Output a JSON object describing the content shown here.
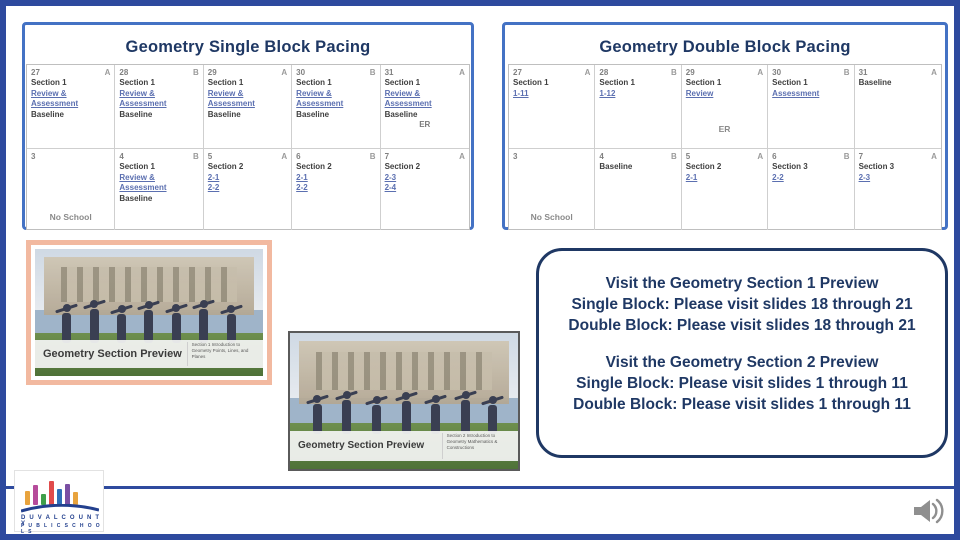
{
  "slide": {
    "accent_border": "#2e4a9e",
    "panel_border": "#4472c4",
    "title_color": "#1f3864"
  },
  "single_block": {
    "title": "Geometry Single Block Pacing",
    "row1": [
      {
        "num": "27",
        "letter": "A",
        "lines": [
          "Section 1",
          "Review &",
          "Assessment",
          "Baseline"
        ],
        "link_lines": [
          1,
          2
        ]
      },
      {
        "num": "28",
        "letter": "B",
        "lines": [
          "Section 1",
          "Review &",
          "Assessment",
          "Baseline"
        ],
        "link_lines": [
          1,
          2
        ]
      },
      {
        "num": "29",
        "letter": "A",
        "lines": [
          "Section 1",
          "Review &",
          "Assessment",
          "Baseline"
        ],
        "link_lines": [
          1,
          2
        ]
      },
      {
        "num": "30",
        "letter": "B",
        "lines": [
          "Section 1",
          "Review &",
          "Assessment",
          "Baseline"
        ],
        "link_lines": [
          1,
          2
        ]
      },
      {
        "num": "31",
        "letter": "A",
        "lines": [
          "Section 1",
          "Review &",
          "Assessment",
          "Baseline",
          "ER"
        ],
        "link_lines": [
          1,
          2
        ]
      }
    ],
    "row2": [
      {
        "num": "3",
        "letter": "",
        "lines": [],
        "note": "No School"
      },
      {
        "num": "4",
        "letter": "B",
        "lines": [
          "Section 1",
          "Review &",
          "Assessment",
          "Baseline"
        ],
        "link_lines": [
          1,
          2
        ]
      },
      {
        "num": "5",
        "letter": "A",
        "lines": [
          "Section 2",
          "2-1",
          "2-2"
        ],
        "link_lines": [
          1,
          2
        ]
      },
      {
        "num": "6",
        "letter": "B",
        "lines": [
          "Section 2",
          "2-1",
          "2-2"
        ],
        "link_lines": [
          1,
          2
        ]
      },
      {
        "num": "7",
        "letter": "A",
        "lines": [
          "Section 2",
          "2-3",
          "2-4"
        ],
        "link_lines": [
          1,
          2
        ]
      }
    ]
  },
  "double_block": {
    "title": "Geometry Double Block Pacing",
    "row1": [
      {
        "num": "27",
        "letter": "A",
        "lines": [
          "Section 1",
          "1-11"
        ],
        "link_lines": [
          1
        ]
      },
      {
        "num": "28",
        "letter": "B",
        "lines": [
          "Section 1",
          "1-12"
        ],
        "link_lines": [
          1
        ]
      },
      {
        "num": "29",
        "letter": "A",
        "lines": [
          "Section 1",
          "Review"
        ],
        "link_lines": [
          1
        ]
      },
      {
        "num": "30",
        "letter": "B",
        "lines": [
          "Section 1",
          "Assessment"
        ],
        "link_lines": [
          1
        ]
      },
      {
        "num": "31",
        "letter": "A",
        "lines": [
          "Baseline"
        ],
        "link_lines": [],
        "sub": "ER"
      }
    ],
    "row2": [
      {
        "num": "3",
        "letter": "",
        "lines": [],
        "note": "No School"
      },
      {
        "num": "4",
        "letter": "B",
        "lines": [
          "Baseline"
        ],
        "link_lines": []
      },
      {
        "num": "5",
        "letter": "A",
        "lines": [
          "Section 2",
          "2-1"
        ],
        "link_lines": [
          1
        ]
      },
      {
        "num": "6",
        "letter": "B",
        "lines": [
          "Section 3",
          "2-2"
        ],
        "link_lines": [
          1
        ]
      },
      {
        "num": "7",
        "letter": "A",
        "lines": [
          "Section 3",
          "2-3"
        ],
        "link_lines": [
          1
        ]
      }
    ]
  },
  "callout": {
    "group1": [
      "Visit the Geometry Section 1 Preview",
      "Single Block: Please visit slides 18 through 21",
      "Double Block: Please visit slides 18 through 21"
    ],
    "group2": [
      "Visit the Geometry Section 2 Preview",
      "Single Block: Please visit slides 1 through 11",
      "Double Block: Please visit slides 1 through 11"
    ]
  },
  "preview_thumb_1": {
    "caption": "Geometry Section Preview",
    "side_caption": "Section 1\nIntroduction to Geometry\nPoints, Lines, and Planes"
  },
  "preview_thumb_2": {
    "caption": "Geometry Section Preview",
    "side_caption": "Section 2\nIntroduction to Geometry\nMathematics &\nConstructions"
  },
  "logo": {
    "line1": "D U V A L   C O U N T Y",
    "line2": "P U B L I C   S C H O O L S",
    "bar_colors": [
      "#e8a33d",
      "#b64b9b",
      "#3f9f4a",
      "#e04b4b",
      "#2f6fb8",
      "#7a4fa3",
      "#e8a33d"
    ],
    "swoosh_color": "#23408e"
  },
  "audio": {
    "icon": "speaker-icon"
  }
}
